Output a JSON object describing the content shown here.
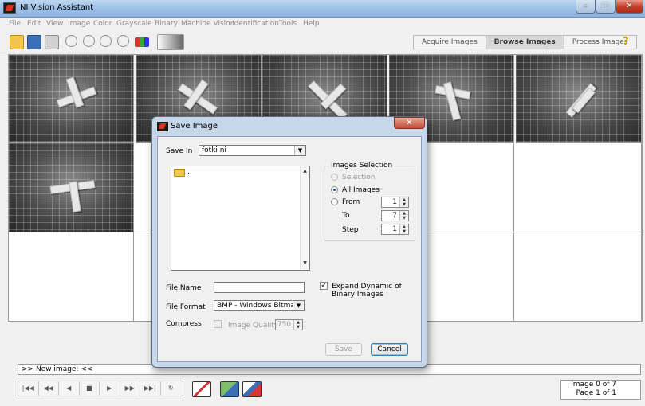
{
  "window": {
    "title": "NI Vision Assistant"
  },
  "titlebar_buttons": {
    "minimize": "–",
    "maximize": "□",
    "close": "✕"
  },
  "menu": [
    "File",
    "Edit",
    "View",
    "Image",
    "Color",
    "Grayscale",
    "Binary",
    "Machine Vision",
    "Identification",
    "Tools",
    "Help"
  ],
  "toolbar": {
    "icons": [
      "open-folder-icon",
      "save-icon",
      "print-icon",
      "zoom-in-icon",
      "zoom-out-icon",
      "zoom-1to1-icon",
      "zoom-fit-icon",
      "palette-icon",
      "gradient-icon"
    ],
    "mode_tabs": [
      {
        "label": "Acquire Images",
        "active": false
      },
      {
        "label": "Browse Images",
        "active": true
      },
      {
        "label": "Process Images",
        "active": false
      }
    ],
    "help": "?"
  },
  "console": {
    "text": ">> New image:  <<"
  },
  "navigation": {
    "buttons": [
      "first-icon",
      "prev-page-icon",
      "prev-icon",
      "stop-icon",
      "next-icon",
      "next-page-icon",
      "last-icon",
      "refresh-icon"
    ]
  },
  "image_counter": {
    "image": "Image  0 of 7",
    "page": "Page  1 of 1"
  },
  "dialog": {
    "title": "Save Image",
    "close": "✕",
    "save_in_label": "Save In",
    "save_in_value": "fotki ni",
    "file_list": [
      ".."
    ],
    "images_selection": {
      "title": "Images Selection",
      "selection_label": "Selection",
      "all_images_label": "All Images",
      "from_label": "From",
      "from_value": "1",
      "to_label": "To",
      "to_value": "7",
      "step_label": "Step",
      "step_value": "1",
      "selected": "All Images"
    },
    "file_name_label": "File Name",
    "file_name_value": "",
    "file_format_label": "File Format",
    "file_format_value": "BMP - Windows Bitmap",
    "compress_label": "Compress",
    "image_quality_label": "Image Quality",
    "image_quality_value": "750",
    "expand_dynamic_label_1": "Expand Dynamic of",
    "expand_dynamic_label_2": "Binary Images",
    "expand_dynamic_checked": true,
    "save_button": "Save",
    "cancel_button": "Cancel"
  }
}
